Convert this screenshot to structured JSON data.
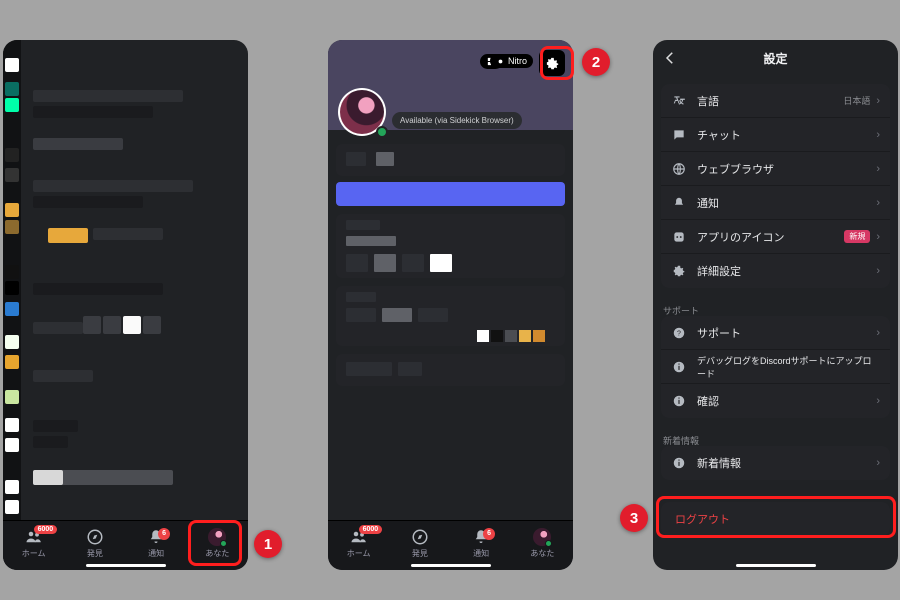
{
  "meta": {
    "app": "Discord",
    "locale": "ja-JP"
  },
  "callouts": {
    "one": "1",
    "two": "2",
    "three": "3"
  },
  "tabbar": {
    "home": {
      "label": "ホーム",
      "badge": "6000"
    },
    "hakken": {
      "label": "発見"
    },
    "tsuchi": {
      "label": "通知",
      "badge": "6"
    },
    "anata": {
      "label": "あなた"
    }
  },
  "screen2": {
    "nitro_label": "Nitro",
    "status_text": "Available (via Sidekick Browser)"
  },
  "screen3": {
    "header_title": "設定",
    "app_settings": {
      "language": {
        "label": "言語",
        "value": "日本語"
      },
      "chat": {
        "label": "チャット"
      },
      "browser": {
        "label": "ウェブブラウザ"
      },
      "notify": {
        "label": "通知"
      },
      "app_icon": {
        "label": "アプリのアイコン",
        "badge": "新規"
      },
      "advanced": {
        "label": "詳細設定"
      }
    },
    "support_section_label": "サポート",
    "support": {
      "support": {
        "label": "サポート"
      },
      "debuglog": {
        "label": "デバッグログをDiscordサポートにアップロード"
      },
      "confirm": {
        "label": "確認"
      }
    },
    "news_section_label": "新着情報",
    "news": {
      "news": {
        "label": "新着情報"
      }
    },
    "logout_label": "ログアウト"
  }
}
